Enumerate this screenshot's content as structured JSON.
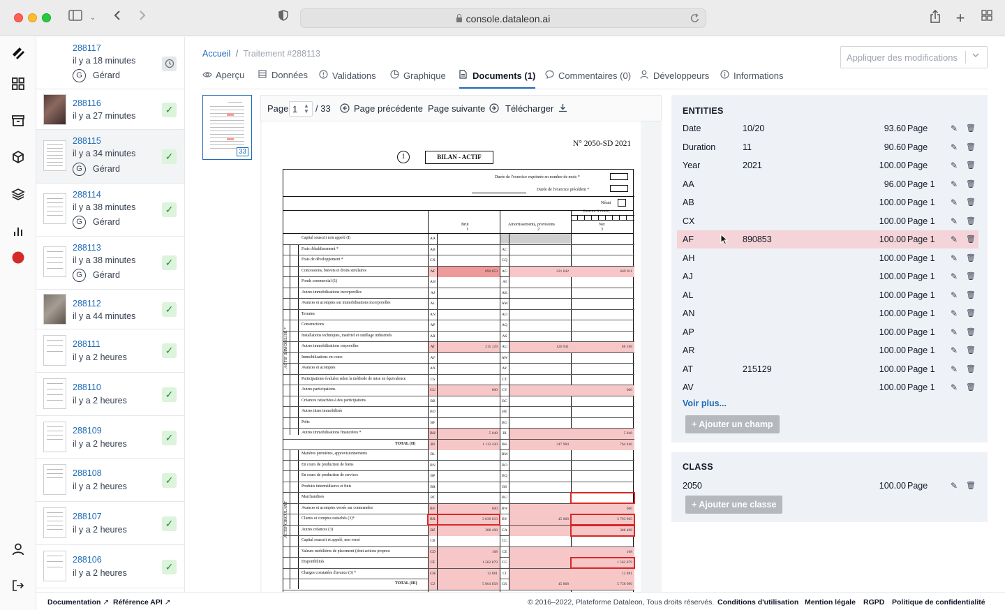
{
  "browser": {
    "url": "console.dataleon.ai"
  },
  "jobs": [
    {
      "id": "288117",
      "time": "il y a 18 minutes",
      "user": "Gérard",
      "user_initial": "G",
      "status": "pending"
    },
    {
      "id": "288116",
      "time": "il y a 27 minutes",
      "status": "done"
    },
    {
      "id": "288115",
      "time": "il y a 34 minutes",
      "user": "Gérard",
      "user_initial": "G",
      "status": "done"
    },
    {
      "id": "288114",
      "time": "il y a 38 minutes",
      "user": "Gérard",
      "user_initial": "G",
      "status": "done"
    },
    {
      "id": "288113",
      "time": "il y a 38 minutes",
      "user": "Gérard",
      "user_initial": "G",
      "status": "done"
    },
    {
      "id": "288112",
      "time": "il y a 44 minutes",
      "status": "done"
    },
    {
      "id": "288111",
      "time": "il y a 2 heures",
      "status": "done"
    },
    {
      "id": "288110",
      "time": "il y a 2 heures",
      "status": "done"
    },
    {
      "id": "288109",
      "time": "il y a 2 heures",
      "status": "done"
    },
    {
      "id": "288108",
      "time": "il y a 2 heures",
      "status": "done"
    },
    {
      "id": "288107",
      "time": "il y a 2 heures",
      "status": "done"
    },
    {
      "id": "288106",
      "time": "il y a 2 heures",
      "status": "done"
    }
  ],
  "breadcrumb": {
    "home": "Accueil",
    "sep": "/",
    "current": "Traitement #288113"
  },
  "apply_select": {
    "placeholder": "Appliquer des modifications"
  },
  "tabs": [
    {
      "label": "Aperçu",
      "icon": "eye-icon"
    },
    {
      "label": "Données",
      "icon": "database-icon"
    },
    {
      "label": "Validations",
      "icon": "alert-circle-icon"
    },
    {
      "label": "Graphique",
      "icon": "pie-chart-icon"
    },
    {
      "label": "Documents (1)",
      "icon": "document-icon",
      "active": true
    },
    {
      "label": "Commentaires (0)",
      "icon": "comment-icon"
    },
    {
      "label": "Développeurs",
      "icon": "user-icon"
    },
    {
      "label": "Informations",
      "icon": "info-icon"
    }
  ],
  "viewer": {
    "page_label": "Page",
    "page_value": "1",
    "page_total": "/ 33",
    "prev": "Page précédente",
    "next": "Page suivante",
    "download": "Télécharger",
    "thumb_badge": "33"
  },
  "doc": {
    "form_no": "N° 2050-SD 2021",
    "circle": "1",
    "title": "BILAN - ACTIF",
    "duree_mois": "Durée de l'exercice exprimée en nombre de mois *",
    "duree_prec": "Durée de l'exercice précédent *",
    "neant": "Néant",
    "exercice": "Exercice N clos le,",
    "col_brut": "Brut",
    "col_amort": "Amortissements, provisions",
    "col_net": "Net",
    "col_1": "1",
    "col_2": "2",
    "col_3": "3",
    "side_actif": "ACTIF IMMOBILISÉ *",
    "side_circulant": "ACTIF CIRCULANT",
    "rows": [
      {
        "label": "Capital souscrit non appelé    (I)",
        "c1": "AA",
        "c2": ""
      },
      {
        "label": "Frais d'établissement *",
        "c1": "AB",
        "c2": "AC"
      },
      {
        "label": "Frais de développement *",
        "c1": "CX",
        "c2": "CQ"
      },
      {
        "label": "Concessions, brevets et droits similaires",
        "c1": "AF",
        "c2": "AG",
        "v1": "890 853",
        "v2": "221 042",
        "v3": "669 811",
        "hl": true
      },
      {
        "label": "Fonds commercial (1)",
        "c1": "AH",
        "c2": "AI"
      },
      {
        "label": "Autres immobilisations incorporelles",
        "c1": "AJ",
        "c2": "AK"
      },
      {
        "label": "Avances et acomptes sur immobilisations incorporelles",
        "c1": "AL",
        "c2": "AM"
      },
      {
        "label": "Terrains",
        "c1": "AN",
        "c2": "AO"
      },
      {
        "label": "Constructions",
        "c1": "AP",
        "c2": "AQ"
      },
      {
        "label": "Installations techniques, matériel et outillage industriels",
        "c1": "AR",
        "c2": "AS"
      },
      {
        "label": "Autres immobilisations corporelles",
        "c1": "AT",
        "c2": "AU",
        "v1": "215 129",
        "v2": "126 941",
        "v3": "88 188",
        "hl": true
      },
      {
        "label": "Immobilisations en cours",
        "c1": "AV",
        "c2": "AW"
      },
      {
        "label": "Avances et acomptes",
        "c1": "AX",
        "c2": "AY"
      },
      {
        "label": "Participations évaluées selon la méthode de mise en équivalence",
        "c1": "CS",
        "c2": "CT"
      },
      {
        "label": "Autres participations",
        "c1": "CU",
        "c2": "CV",
        "v1": "600",
        "v3": "600",
        "hl": true
      },
      {
        "label": "Créances rattachées à des participations",
        "c1": "BB",
        "c2": "BC"
      },
      {
        "label": "Autres titres immobilisés",
        "c1": "BD",
        "c2": "BE"
      },
      {
        "label": "Prêts",
        "c1": "BF",
        "c2": "BG"
      },
      {
        "label": "Autres immobilisations financières *",
        "c1": "BH",
        "c2": "BI",
        "v1": "5 848",
        "v3": "5 848",
        "hl": true
      },
      {
        "label": "TOTAL (II)",
        "c1": "BJ",
        "c2": "BK",
        "v1": "1 112 430",
        "v2": "347 984",
        "v3": "764 446",
        "hl": true,
        "total": true
      },
      {
        "label": "Matières premières, approvisionnements",
        "c1": "BL",
        "c2": "BM"
      },
      {
        "label": "En cours de production de biens",
        "c1": "BN",
        "c2": "BO"
      },
      {
        "label": "En cours de production de services",
        "c1": "BP",
        "c2": "BQ"
      },
      {
        "label": "Produits intermédiaires et finis",
        "c1": "BR",
        "c2": "BS"
      },
      {
        "label": "Marchandises",
        "c1": "BT",
        "c2": "BU",
        "box3": true
      },
      {
        "label": "Avances et acomptes versés sur commandes",
        "c1": "BV",
        "c2": "BW",
        "v1": "600",
        "v3": "600",
        "hl": true
      },
      {
        "label": "Clients et comptes rattachés (3)*",
        "c1": "BX",
        "c2": "BY",
        "v1": "3 839 833",
        "v2": "45 868",
        "v3": "3 793 965",
        "hl": true,
        "box1": true,
        "box3": true
      },
      {
        "label": "Autres créances (3)",
        "c1": "BZ",
        "c2": "CA",
        "v1": "388 498",
        "v3": "388 498",
        "hl": true,
        "box3": true
      },
      {
        "label": "Capital souscrit et appelé, non versé",
        "c1": "CB",
        "c2": "CC"
      },
      {
        "label": "Valeurs mobilières de placement (dont actions propres:",
        "c1": "CD",
        "c2": "CE",
        "v1": "168",
        "v3": "168",
        "hl": true
      },
      {
        "label": "Disponibilités",
        "c1": "CF",
        "c2": "CG",
        "v1": "1 562 879",
        "v3": "1 562 879",
        "hl": true,
        "box3": true
      },
      {
        "label": "Charges constatées d'avance (3) *",
        "c1": "CH",
        "c2": "CI",
        "v1": "12 881",
        "v3": "12 881",
        "hl": true
      },
      {
        "label": "TOTAL (III)",
        "c1": "CJ",
        "c2": "CK",
        "v1": "5 804 858",
        "v2": "45 868",
        "v3": "5 758 990",
        "hl": true,
        "total": true
      }
    ]
  },
  "entities": {
    "title": "ENTITIES",
    "rows": [
      {
        "key": "Date",
        "value": "10/20",
        "score": "93.60",
        "page": "Page"
      },
      {
        "key": "Duration",
        "value": "11",
        "score": "90.60",
        "page": "Page"
      },
      {
        "key": "Year",
        "value": "2021",
        "score": "100.00",
        "page": "Page"
      },
      {
        "key": "AA",
        "value": "",
        "score": "96.00",
        "page": "Page 1"
      },
      {
        "key": "AB",
        "value": "",
        "score": "100.00",
        "page": "Page 1"
      },
      {
        "key": "CX",
        "value": "",
        "score": "100.00",
        "page": "Page 1"
      },
      {
        "key": "AF",
        "value": "890853",
        "score": "100.00",
        "page": "Page 1",
        "highlight": true
      },
      {
        "key": "AH",
        "value": "",
        "score": "100.00",
        "page": "Page 1"
      },
      {
        "key": "AJ",
        "value": "",
        "score": "100.00",
        "page": "Page 1"
      },
      {
        "key": "AL",
        "value": "",
        "score": "100.00",
        "page": "Page 1"
      },
      {
        "key": "AN",
        "value": "",
        "score": "100.00",
        "page": "Page 1"
      },
      {
        "key": "AP",
        "value": "",
        "score": "100.00",
        "page": "Page 1"
      },
      {
        "key": "AR",
        "value": "",
        "score": "100.00",
        "page": "Page 1"
      },
      {
        "key": "AT",
        "value": "215129",
        "score": "100.00",
        "page": "Page 1"
      },
      {
        "key": "AV",
        "value": "",
        "score": "100.00",
        "page": "Page 1"
      }
    ],
    "see_more": "Voir plus...",
    "add_field": "+ Ajouter un champ"
  },
  "class": {
    "title": "CLASS",
    "rows": [
      {
        "key": "2050",
        "value": "",
        "score": "100.00",
        "page": "Page"
      }
    ],
    "add_class": "+ Ajouter une classe"
  },
  "footer": {
    "docs": "Documentation",
    "api": "Référence API",
    "copyright": "© 2016–2022, Plateforme Dataleon, Tous droits réservés.",
    "terms": "Conditions d'utilisation",
    "legal": "Mention légale",
    "gdpr": "RGPD",
    "privacy": "Politique de confidentialité"
  },
  "colors": {
    "accent": "#1e6bb8",
    "highlight": "#f4d4d8",
    "status_ok": "#dcf3dc"
  }
}
